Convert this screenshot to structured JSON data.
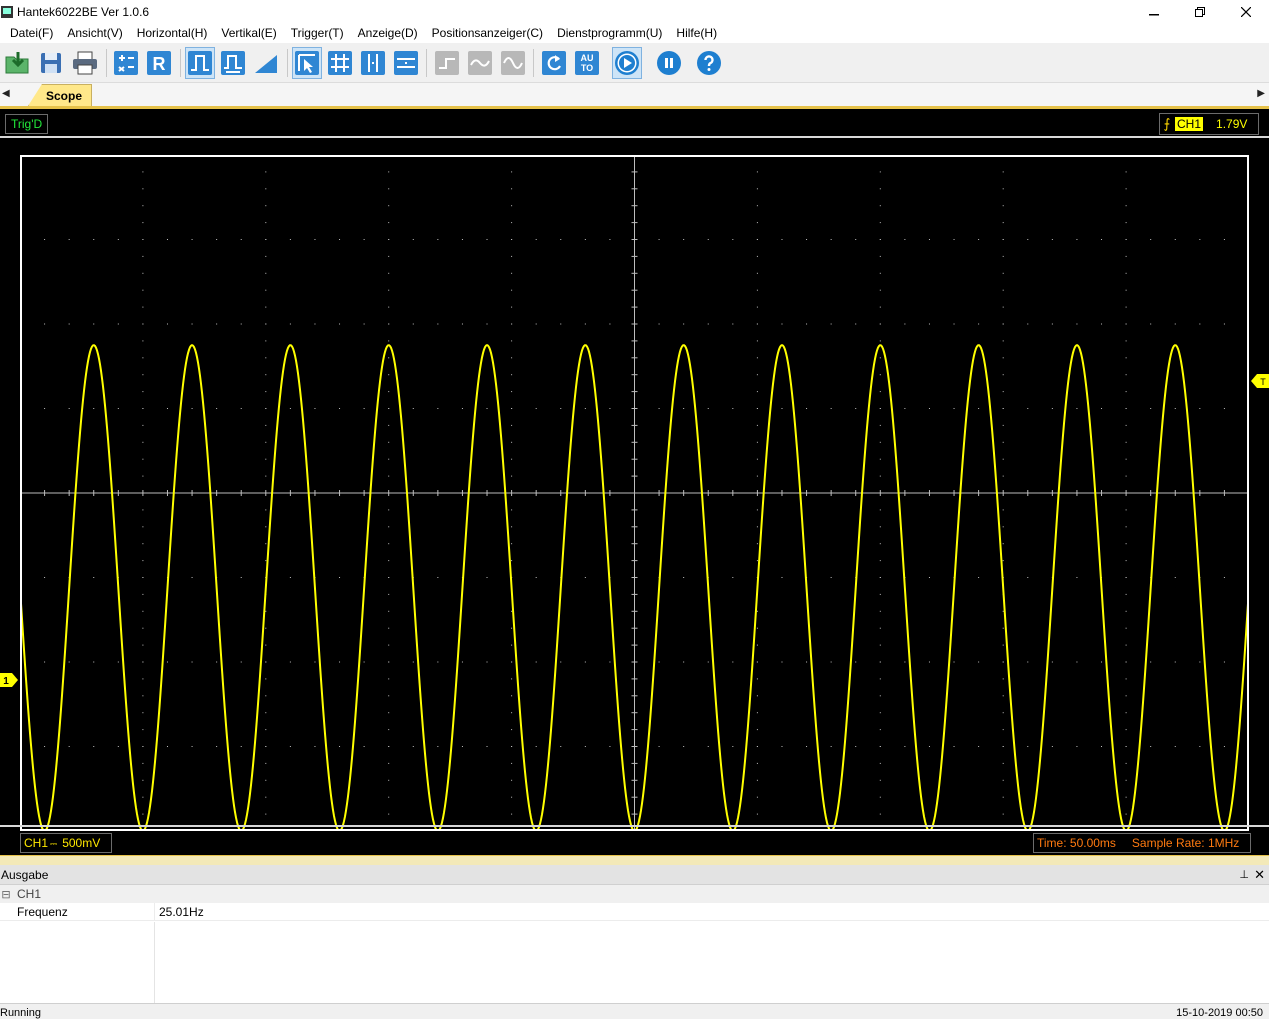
{
  "window": {
    "title": "Hantek6022BE Ver 1.0.6"
  },
  "menu": [
    "Datei(F)",
    "Ansicht(V)",
    "Horizontal(H)",
    "Vertikal(E)",
    "Trigger(T)",
    "Anzeige(D)",
    "Positionsanzeiger(C)",
    "Dienstprogramm(U)",
    "Hilfe(H)"
  ],
  "toolbar": {
    "auto_label_top": "AU",
    "auto_label_bottom": "TO",
    "r_label": "R"
  },
  "tabs": {
    "active": "Scope"
  },
  "scope": {
    "trigger_status": "Trig'D",
    "trigger_channel": "CH1",
    "trigger_level": "1.79V",
    "channel": "CH1",
    "coupling_symbol": "⎓",
    "volts_per_div": "500mV",
    "time_base": "Time: 50.00ms",
    "sample_rate": "Sample Rate: 1MHz",
    "channel_marker": "1",
    "trigger_marker": "T",
    "colors": {
      "trace": "#ffff00",
      "background": "#000000",
      "grid": "#bdbdbd",
      "trig_status": "#22e83a",
      "time_info": "#ff7a10"
    },
    "waveform": {
      "cycles_on_screen": 12.5,
      "frequency_hz": 25.01,
      "offset_div": -1.125,
      "amplitude_div": 2.875,
      "phase_deg": 180
    }
  },
  "output": {
    "title": "Ausgabe",
    "group": "CH1",
    "rows": [
      {
        "key": "Frequenz",
        "value": "25.01Hz"
      }
    ]
  },
  "status": {
    "left": "Running",
    "right": "15-10-2019  00:50"
  }
}
